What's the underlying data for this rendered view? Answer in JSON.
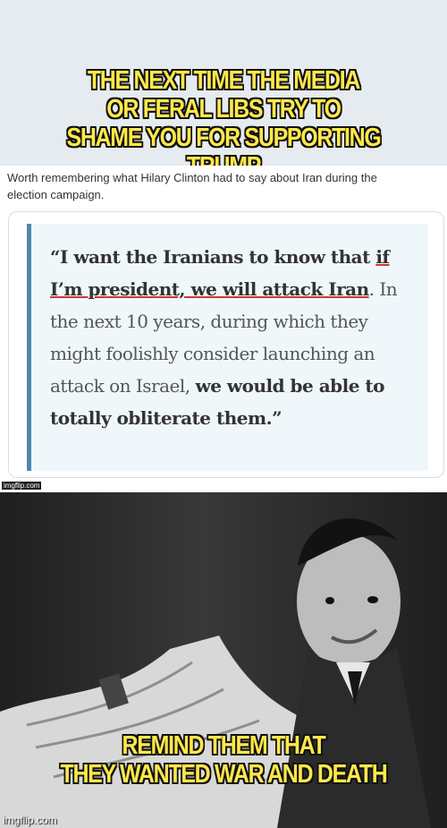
{
  "top_caption": [
    "THE NEXT TIME THE MEDIA",
    "OR FERAL LIBS TRY TO",
    "SHAME YOU FOR SUPPORTING TRUMP"
  ],
  "tweet": {
    "lines": [
      "Worth remembering what Hilary Clinton had to say about Iran during the",
      "election campaign."
    ]
  },
  "quote": {
    "part1": "“I want the Iranians to know that ",
    "part2": "if",
    "part3": "I’m president, we will attack Iran",
    "part4": ". In the next 10 years, during which they might foolishly consider launching an attack on Israel, ",
    "part5": "we would be able to totally obliterate them.",
    "part6": "”"
  },
  "watermark_small": "imgflip.com",
  "bottom_caption": [
    "REMIND THEM THAT",
    "THEY WANTED WAR AND DEATH"
  ],
  "watermark": "imgflip.com",
  "colors": {
    "caption": "#ffe84a",
    "quote_border": "#4f86ad",
    "underline": "#d53333"
  }
}
